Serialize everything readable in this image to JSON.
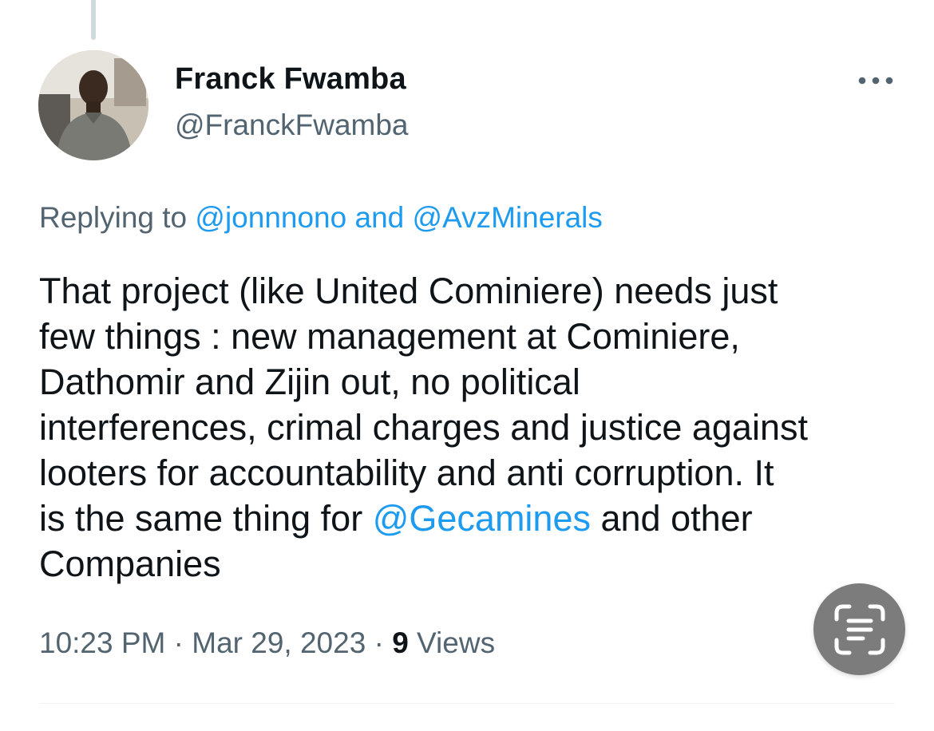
{
  "tweet": {
    "author": {
      "display_name": "Franck Fwamba",
      "handle": "@FranckFwamba"
    },
    "reply": {
      "prefix": "Replying to ",
      "mention_1": "@jonnnono",
      "joiner": " and ",
      "mention_2": "@AvzMinerals"
    },
    "text_lines": [
      "That project (like United Cominiere) needs just",
      "few things : new management at Cominiere,",
      "Dathomir and Zijin out, no political",
      "interferences, crimal charges and justice against",
      "looters for accountability and anti corruption. It"
    ],
    "line6_prefix": "is the same thing for ",
    "line6_mention": "@Gecamines",
    "line6_suffix": " and other",
    "line7": "Companies",
    "time": "10:23 PM",
    "sep1": " · ",
    "date": "Mar 29, 2023",
    "sep2": " · ",
    "views_count": "9",
    "views_label": " Views"
  },
  "icons": {
    "more": "more-horizontal-icon",
    "scan": "text-scan-icon"
  },
  "colors": {
    "link": "#1d9bf0",
    "secondary_text": "#536471",
    "primary_text": "#0f1419",
    "scan_button_bg": "#7c7c7c"
  }
}
